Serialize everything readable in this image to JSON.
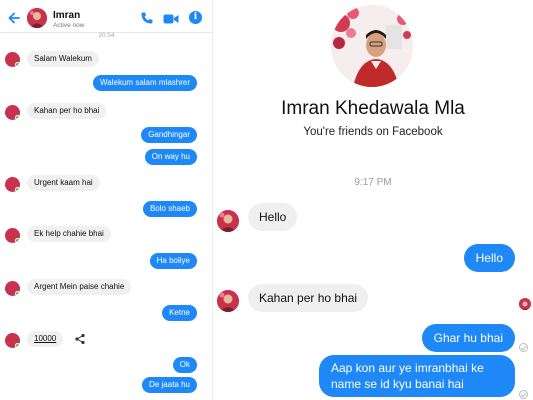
{
  "left": {
    "header": {
      "name": "Imran",
      "status": "Active now",
      "status_time": "20:54"
    },
    "messages": [
      {
        "dir": "in",
        "text": "Salam Walekum"
      },
      {
        "dir": "out",
        "text": "Walekum salam mlashrer"
      },
      {
        "dir": "in",
        "text": "Kahan per ho bhai"
      },
      {
        "dir": "out",
        "text": "Gandhingar"
      },
      {
        "dir": "out",
        "text": "On way hu"
      },
      {
        "dir": "in",
        "text": "Urgent kaam hai"
      },
      {
        "dir": "out",
        "text": "Bolo shaeb"
      },
      {
        "dir": "in",
        "text": "Ek help chahie bhai"
      },
      {
        "dir": "out",
        "text": "Ha boliye"
      },
      {
        "dir": "in",
        "text": "Argent Mein paise chahie"
      },
      {
        "dir": "out",
        "text": "Ketne"
      },
      {
        "dir": "in",
        "text": "10000"
      },
      {
        "dir": "out",
        "text": "Ok"
      },
      {
        "dir": "out",
        "text": "De jaata hu"
      }
    ]
  },
  "right": {
    "profile_name": "Imran Khedawala Mla",
    "friends_text": "You're friends on Facebook",
    "timestamp": "9:17 PM",
    "messages": [
      {
        "dir": "in",
        "text": "Hello"
      },
      {
        "dir": "out",
        "text": "Hello"
      },
      {
        "dir": "in",
        "text": "Kahan per ho bhai"
      },
      {
        "dir": "out",
        "text": "Ghar hu bhai"
      },
      {
        "dir": "out",
        "text": "Aap kon aur ye imranbhai ke name se id kyu banai hai"
      }
    ]
  },
  "colors": {
    "accent": "#1e88f7",
    "incoming_bubble": "#f0f0f0",
    "online": "#3ac63a"
  },
  "icons": [
    "back-arrow-icon",
    "phone-icon",
    "video-icon",
    "info-icon",
    "share-icon",
    "check-icon"
  ]
}
